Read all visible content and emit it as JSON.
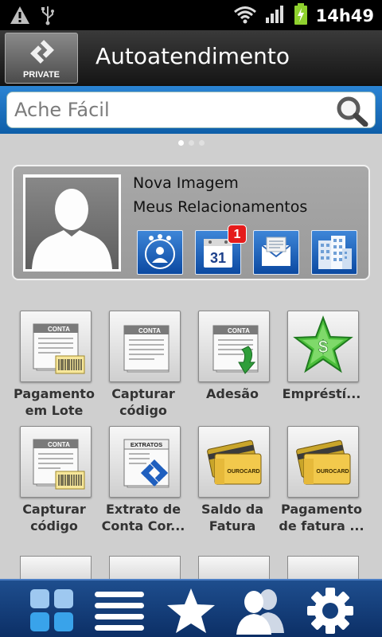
{
  "status_bar": {
    "time": "14h49",
    "icons": [
      "warning-icon",
      "usb-icon",
      "wifi-icon",
      "signal-icon",
      "battery-charging-icon"
    ]
  },
  "header": {
    "logo_text": "PRIVATE",
    "title": "Autoatendimento"
  },
  "search": {
    "placeholder": "Ache Fácil",
    "icon": "search-icon"
  },
  "pager": {
    "pages": 3,
    "active": 1
  },
  "profile": {
    "line1": "Nova Imagem",
    "line2": "Meus Relacionamentos",
    "actions": [
      {
        "icon": "relationship-manager-icon"
      },
      {
        "icon": "calendar-icon",
        "calendar_day": "31",
        "badge": "1"
      },
      {
        "icon": "mail-icon"
      },
      {
        "icon": "buildings-icon"
      }
    ]
  },
  "grid": [
    {
      "label": "Pagamento\nem Lote",
      "icon": "bill-barcode-icon",
      "card_text": "CONTA"
    },
    {
      "label": "Capturar\ncódigo",
      "icon": "bill-icon",
      "card_text": "CONTA"
    },
    {
      "label": "Adesão",
      "icon": "bill-arrow-icon",
      "card_text": "CONTA"
    },
    {
      "label": "Empréstí...",
      "icon": "money-star-icon",
      "card_text": "$"
    },
    {
      "label": "Capturar\ncódigo",
      "icon": "bill-barcode-icon",
      "card_text": "CONTA"
    },
    {
      "label": "Extrato de\nConta Cor...",
      "icon": "statement-icon",
      "card_text": "EXTRATOS"
    },
    {
      "label": "Saldo da\nFatura",
      "icon": "credit-cards-icon",
      "card_text": "OUROCARD"
    },
    {
      "label": "Pagamento\nde fatura ...",
      "icon": "credit-cards-icon",
      "card_text": "OUROCARD"
    }
  ],
  "bottom_bar": {
    "buttons": [
      "grid-view-icon",
      "list-view-icon",
      "favorites-star-icon",
      "contacts-icon",
      "settings-gear-icon"
    ]
  },
  "colors": {
    "header_bg": "#262626",
    "search_bg": "#1a72c2",
    "bottom_bar_bg": "#143f7c",
    "badge_red": "#e51b1b"
  }
}
